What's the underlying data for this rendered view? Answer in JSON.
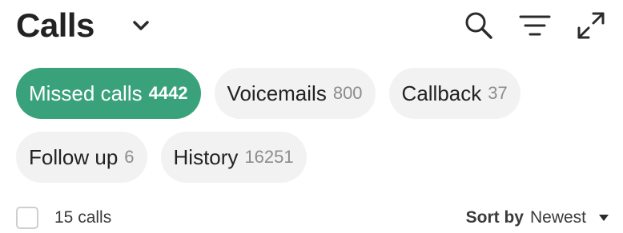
{
  "header": {
    "title": "Calls",
    "icons": [
      "chevron-down-icon",
      "search-icon",
      "filter-icon",
      "expand-icon"
    ]
  },
  "chips": {
    "row1": [
      {
        "label": "Missed calls",
        "count": "4442",
        "active": true
      },
      {
        "label": "Voicemails",
        "count": "800",
        "active": false
      },
      {
        "label": "Callback",
        "count": "37",
        "active": false
      }
    ],
    "row2": [
      {
        "label": "Follow up",
        "count": "6",
        "active": false
      },
      {
        "label": "History",
        "count": "16251",
        "active": false
      }
    ]
  },
  "footer": {
    "calls_count": "15 calls",
    "sort_label": "Sort by",
    "sort_value": "Newest"
  },
  "colors": {
    "accent": "#3aa27b",
    "chip_bg": "#f2f2f2",
    "muted_text": "#8c8c8c"
  }
}
